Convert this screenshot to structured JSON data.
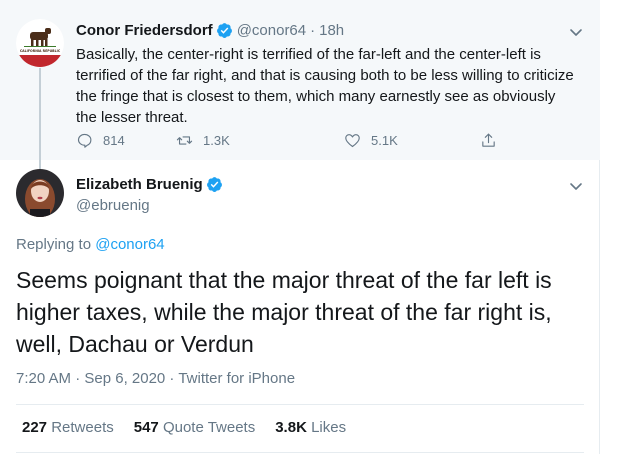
{
  "parent_tweet": {
    "name": "Conor Friedersdorf",
    "handle": "@conor64",
    "separator": "·",
    "time": "18h",
    "avatar_label": "CALIFORNIA REPUBLIC",
    "text": "Basically, the center-right is terrified of the far-left and the center-left is terrified of the far right, and that is causing both to be less willing to criticize the fringe that is closest to them, which many earnestly see as obviously the lesser threat.",
    "reply_count": "814",
    "retweet_count": "1.3K",
    "like_count": "5.1K"
  },
  "main_tweet": {
    "name": "Elizabeth Bruenig",
    "handle": "@ebruenig",
    "replying_prefix": "Replying to",
    "replying_to": "@conor64",
    "text": "Seems poignant that the major threat of the far left is higher taxes, while the major threat of the far right is, well, Dachau or Verdun",
    "time": "7:20 AM · Sep 6, 2020 · Twitter for iPhone",
    "stats": [
      {
        "count": "227",
        "label": "Retweets"
      },
      {
        "count": "547",
        "label": "Quote Tweets"
      },
      {
        "count": "3.8K",
        "label": "Likes"
      }
    ]
  },
  "colors": {
    "accent": "#1da1f2",
    "secondary_text": "#657786",
    "parent_bg": "#f5f8fa"
  }
}
